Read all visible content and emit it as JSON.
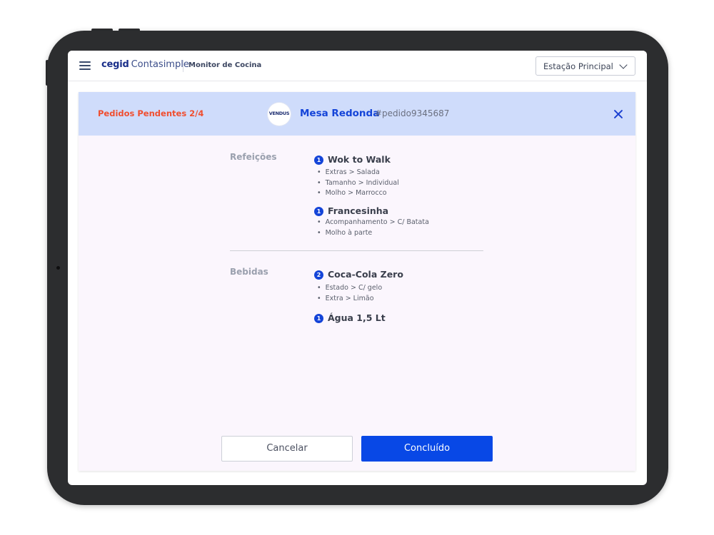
{
  "header": {
    "brand_cegid": "cegid",
    "brand_name": "Contasimple",
    "module_title": "Monitor de Cocina",
    "station_select": "Estação Principal"
  },
  "order": {
    "pending_label": "Pedidos Pendentes 2/4",
    "channel_logo_text": "VENDUS",
    "table_name": "Mesa Redonda",
    "order_id": "#pedido9345687"
  },
  "sections": [
    {
      "label": "Refeições",
      "items": [
        {
          "qty": "1",
          "name": "Wok to Walk",
          "modifiers": [
            "Extras > Salada",
            "Tamanho > Individual",
            "Molho > Marrocco"
          ]
        },
        {
          "qty": "1",
          "name": "Francesinha",
          "modifiers": [
            "Acompanhamento > C/ Batata",
            "Molho à parte"
          ]
        }
      ]
    },
    {
      "label": "Bebidas",
      "items": [
        {
          "qty": "2",
          "name": "Coca-Cola Zero",
          "modifiers": [
            "Estado > C/ gelo",
            "Extra > Limão"
          ]
        },
        {
          "qty": "1",
          "name": "Água 1,5 Lt",
          "modifiers": []
        }
      ]
    }
  ],
  "actions": {
    "cancel": "Cancelar",
    "done": "Concluído"
  },
  "colors": {
    "accent": "#0848e6",
    "pending": "#f04e2f",
    "header_band": "#cfdcfb",
    "card_bg": "#fbf6fd"
  }
}
